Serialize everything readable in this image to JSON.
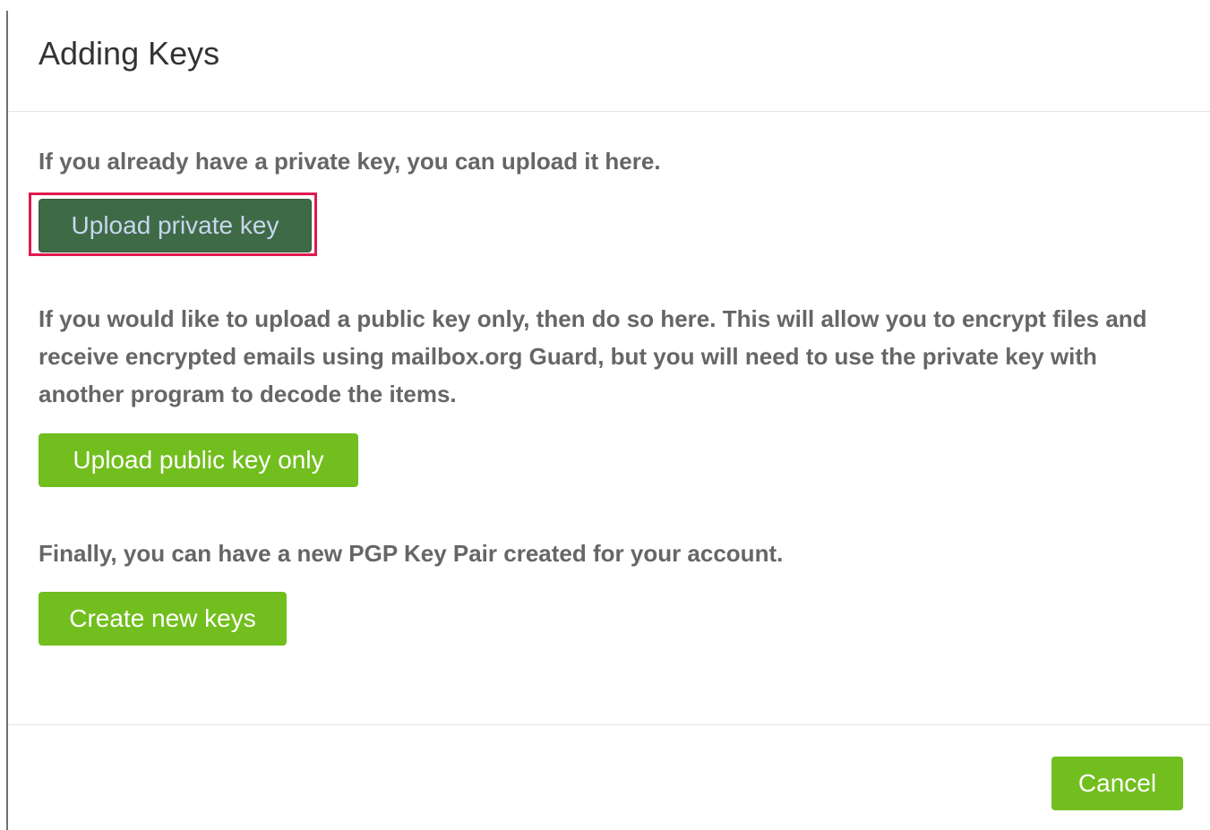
{
  "dialog": {
    "title": "Adding Keys",
    "sections": [
      {
        "text": "If you already have a private key, you can upload it here.",
        "button_label": "Upload private key"
      },
      {
        "text": "If you would like to upload a public key only, then do so here. This will allow you to encrypt files and receive encrypted emails using mailbox.org Guard, but you will need to use the private key with another program to decode the items.",
        "button_label": "Upload public key only"
      },
      {
        "text": "Finally, you can have a new PGP Key Pair created for your account.",
        "button_label": "Create new keys"
      }
    ],
    "footer": {
      "cancel_label": "Cancel"
    }
  },
  "colors": {
    "primary_button": "#72be1e",
    "focused_button": "#3f6a46",
    "highlight_border": "#e0194f",
    "heading_text": "#333333",
    "body_text": "#666666"
  }
}
